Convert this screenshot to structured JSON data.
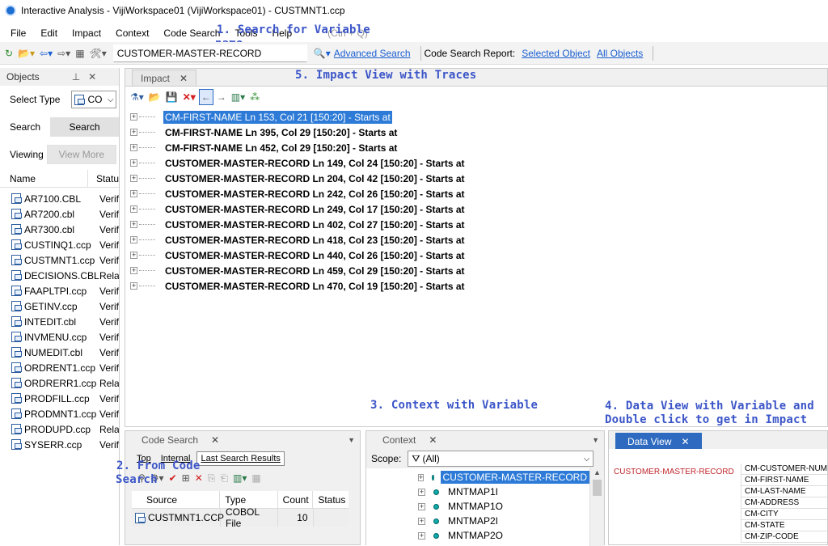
{
  "window": {
    "title": "Interactive Analysis - VijiWorkspace01 (VijiWorkspace01) - CUSTMNT1.ccp"
  },
  "menu": {
    "items": [
      "File",
      "Edit",
      "Impact",
      "Context",
      "Code Search",
      "Tools",
      "Help"
    ],
    "search_hint": "(Ctrl + Q)"
  },
  "toolbar": {
    "search_value": "CUSTOMER-MASTER-RECORD",
    "advanced_search": "Advanced Search",
    "report_label": "Code Search Report:",
    "selected_object": "Selected Object",
    "all_objects": "All Objects"
  },
  "annotations": {
    "a1": "1. Search for Variable",
    "a1b": "name",
    "a2": "2. From Code",
    "a2b": "Search",
    "a3": "3. Context with Variable",
    "a4": "4. Data View with Variable and",
    "a4b": "Double click to get in Impact",
    "a5": "5. Impact View with Traces"
  },
  "objects": {
    "title": "Objects",
    "select_type_label": "Select Type",
    "select_type_value": "CO",
    "search_label": "Search",
    "search_button": "Search",
    "viewing_label": "Viewing",
    "view_more_button": "View More",
    "col_name": "Name",
    "col_status": "Statu",
    "files": [
      {
        "name": "AR7100.CBL",
        "status": "Verif"
      },
      {
        "name": "AR7200.cbl",
        "status": "Verif"
      },
      {
        "name": "AR7300.cbl",
        "status": "Verif"
      },
      {
        "name": "CUSTINQ1.ccp",
        "status": "Verif"
      },
      {
        "name": "CUSTMNT1.ccp",
        "status": "Verif"
      },
      {
        "name": "DECISIONS.CBL",
        "status": "Rela"
      },
      {
        "name": "FAAPLTPI.ccp",
        "status": "Verif"
      },
      {
        "name": "GETINV.ccp",
        "status": "Verif"
      },
      {
        "name": "INTEDIT.cbl",
        "status": "Verif"
      },
      {
        "name": "INVMENU.ccp",
        "status": "Verif"
      },
      {
        "name": "NUMEDIT.cbl",
        "status": "Verif"
      },
      {
        "name": "ORDRENT1.ccp",
        "status": "Verif"
      },
      {
        "name": "ORDRERR1.ccp",
        "status": "Rela"
      },
      {
        "name": "PRODFILL.ccp",
        "status": "Verif"
      },
      {
        "name": "PRODMNT1.ccp",
        "status": "Verif"
      },
      {
        "name": "PRODUPD.ccp",
        "status": "Rela"
      },
      {
        "name": "SYSERR.ccp",
        "status": "Verif"
      }
    ]
  },
  "impact": {
    "tab": "Impact",
    "nodes": [
      "CM-FIRST-NAME Ln 153, Col 21 [150:20] - Starts at",
      "CM-FIRST-NAME Ln 395, Col 29 [150:20] - Starts at",
      "CM-FIRST-NAME Ln 452, Col 29 [150:20] - Starts at",
      "CUSTOMER-MASTER-RECORD Ln 149, Col 24 [150:20] - Starts at",
      "CUSTOMER-MASTER-RECORD Ln 204, Col 42 [150:20] - Starts at",
      "CUSTOMER-MASTER-RECORD Ln 242, Col 26 [150:20] - Starts at",
      "CUSTOMER-MASTER-RECORD Ln 249, Col 17 [150:20] - Starts at",
      "CUSTOMER-MASTER-RECORD Ln 402, Col 27 [150:20] - Starts at",
      "CUSTOMER-MASTER-RECORD Ln 418, Col 23 [150:20] - Starts at",
      "CUSTOMER-MASTER-RECORD Ln 440, Col 26 [150:20] - Starts at",
      "CUSTOMER-MASTER-RECORD Ln 459, Col 29 [150:20] - Starts at",
      "CUSTOMER-MASTER-RECORD Ln 470, Col 19 [150:20] - Starts at"
    ]
  },
  "code_search": {
    "tab": "Code Search",
    "subtabs": [
      "Top",
      "Internal",
      "Last Search Results"
    ],
    "columns": [
      "Source",
      "Type",
      "Count",
      "Status"
    ],
    "row": {
      "source": "CUSTMNT1.CCP",
      "type": "COBOL File",
      "count": "10",
      "status": ""
    }
  },
  "context": {
    "tab": "Context",
    "scope_label": "Scope:",
    "scope_value": "(All)",
    "items": [
      "CUSTOMER-MASTER-RECORD",
      "MNTMAP1I",
      "MNTMAP1O",
      "MNTMAP2I",
      "MNTMAP2O"
    ]
  },
  "data_view": {
    "tab": "Data View",
    "record": "CUSTOMER-MASTER-RECORD",
    "fields": [
      "CM-CUSTOMER-NUM",
      "CM-FIRST-NAME",
      "CM-LAST-NAME",
      "CM-ADDRESS",
      "CM-CITY",
      "CM-STATE",
      "CM-ZIP-CODE"
    ]
  }
}
